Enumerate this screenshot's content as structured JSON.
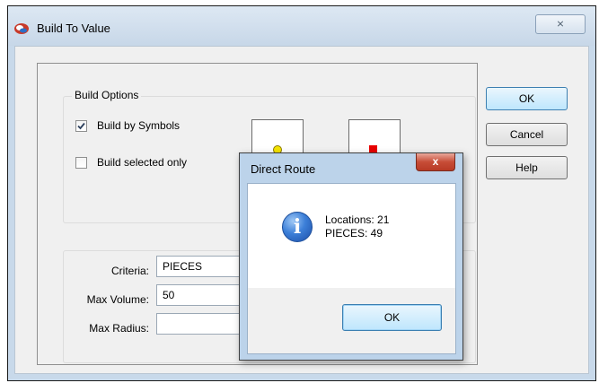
{
  "window": {
    "title": "Build To Value",
    "close_glyph": "⨯"
  },
  "build_options": {
    "legend": "Build Options",
    "build_by_symbols": {
      "label": "Build by Symbols",
      "checked": true
    },
    "build_selected_only": {
      "label": "Build selected only",
      "checked": false
    },
    "symbols": [
      {
        "name": "yellow-circle-symbol",
        "color": "#f5e400"
      },
      {
        "name": "red-square-symbol",
        "color": "#e80000"
      }
    ]
  },
  "criteria": {
    "criteria_label": "Criteria:",
    "criteria_value": "PIECES",
    "max_volume_label": "Max Volume:",
    "max_volume_value": "50",
    "max_radius_label": "Max Radius:",
    "max_radius_value": ""
  },
  "buttons": {
    "ok": "OK",
    "cancel": "Cancel",
    "help": "Help"
  },
  "dialog": {
    "title": "Direct Route",
    "close_glyph": "x",
    "icon": "information-icon",
    "icon_glyph": "i",
    "message_line1": "Locations: 21",
    "message_line2": "PIECES: 49",
    "ok": "OK"
  }
}
